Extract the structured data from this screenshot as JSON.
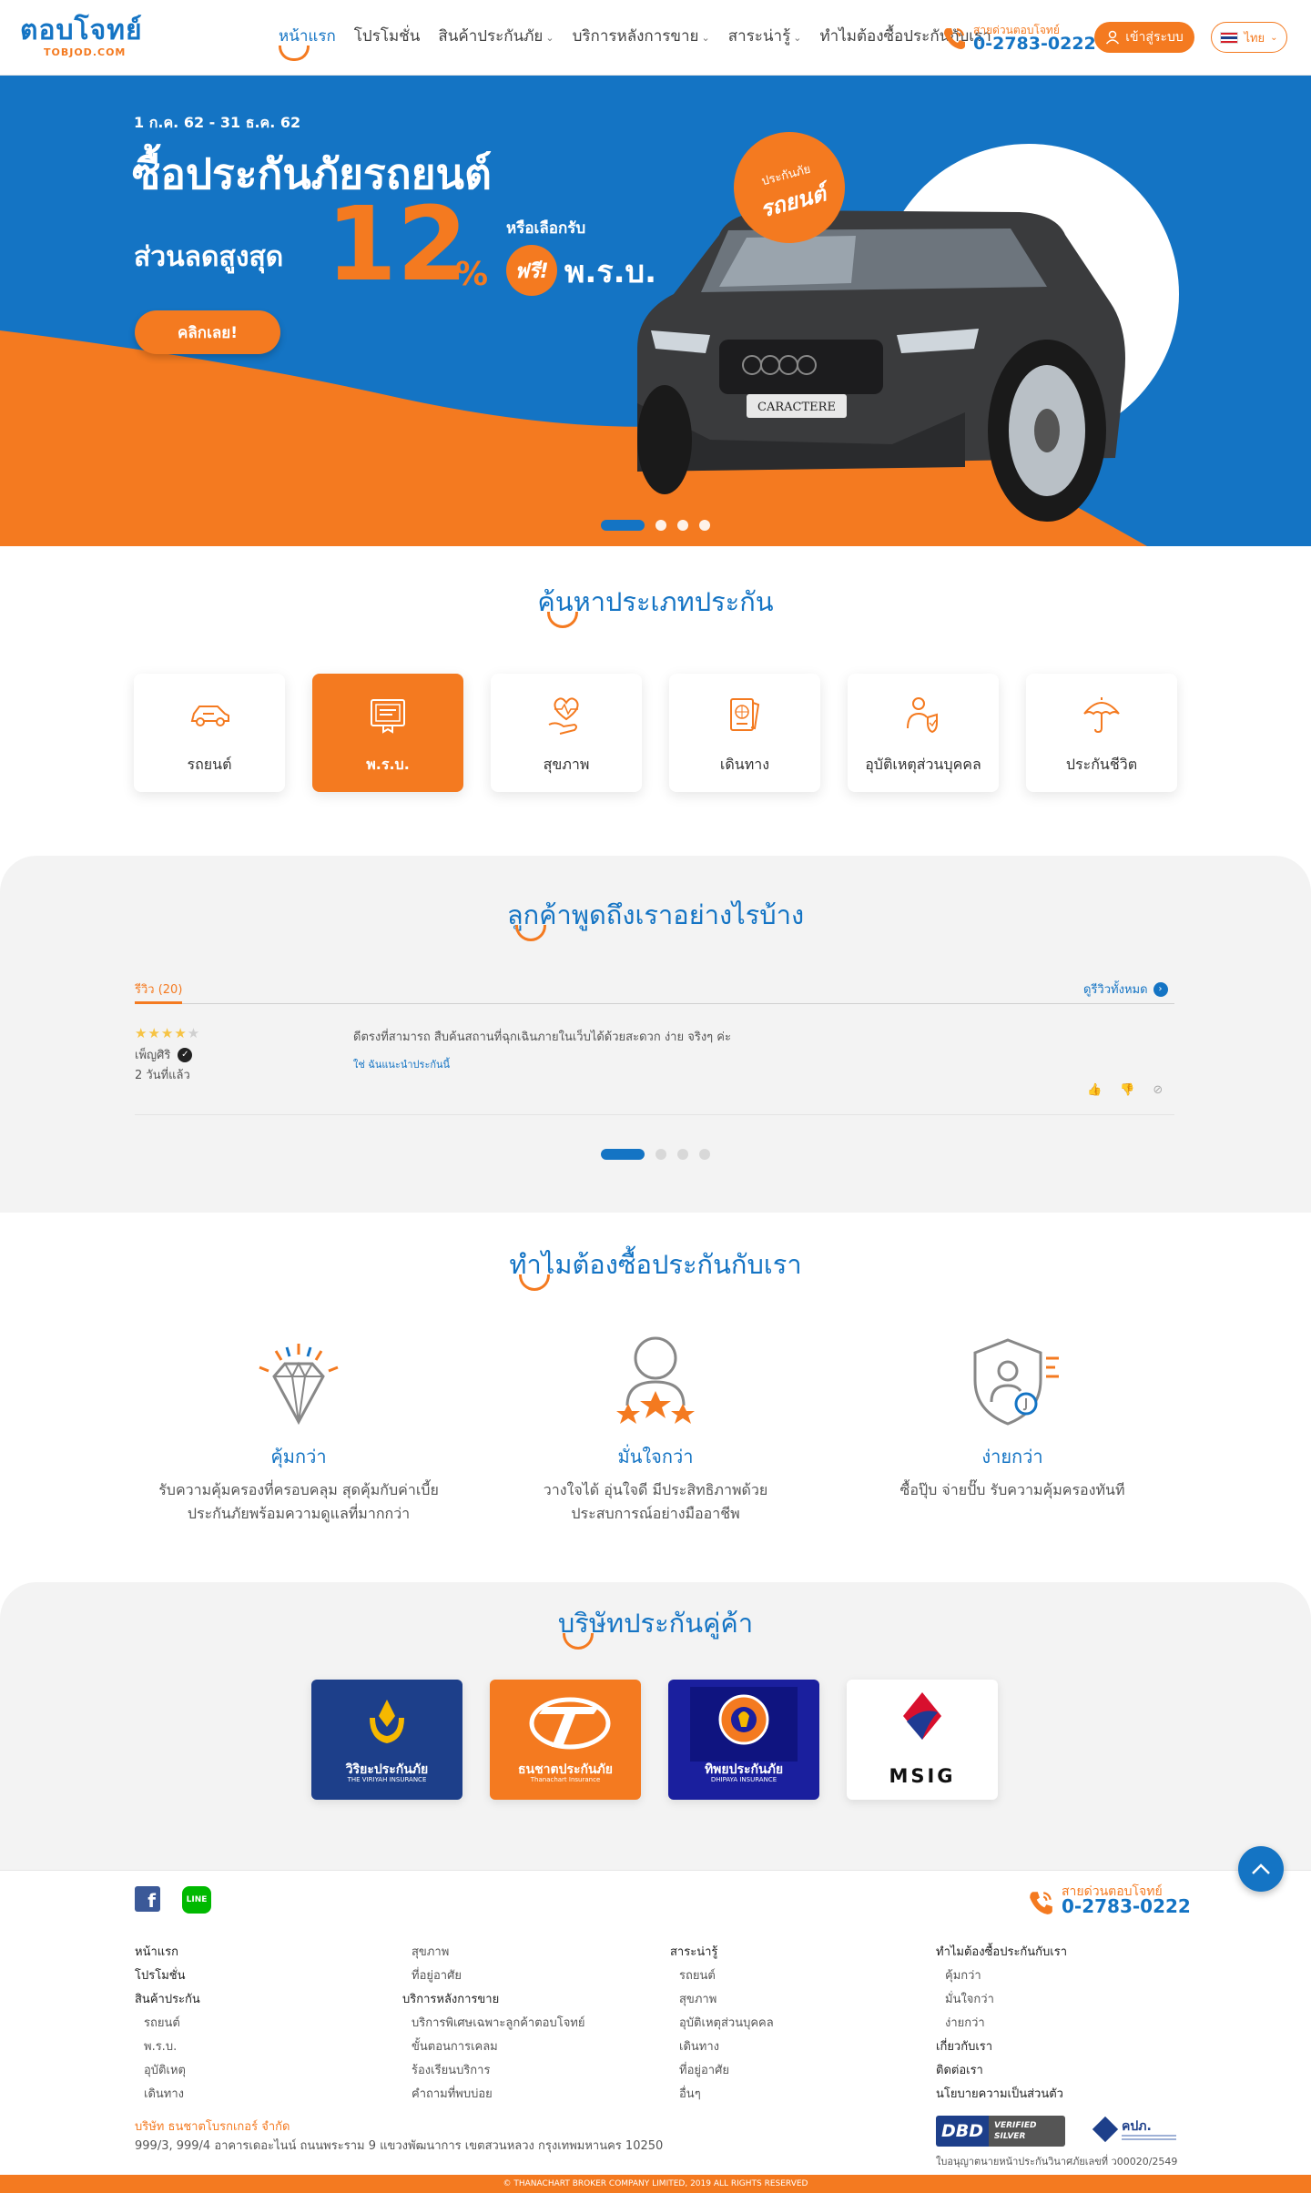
{
  "header": {
    "logo_text": "ตอบโจทย์",
    "logo_sub": "TOBJOD.COM",
    "nav": [
      {
        "label": "หน้าแรก"
      },
      {
        "label": "โปรโมชั่น"
      },
      {
        "label": "สินค้าประกันภัย"
      },
      {
        "label": "บริการหลังการขาย"
      },
      {
        "label": "สาระน่ารู้"
      },
      {
        "label": "ทำไมต้องซื้อประกันกับเรา"
      }
    ],
    "hotline_label": "สายด่วนตอบโจทย์",
    "hotline_number": "0-2783-0222",
    "login_label": "เข้าสู่ระบบ",
    "lang_label": "ไทย"
  },
  "hero": {
    "date_range": "1 ก.ค. 62 - 31 ธ.ค. 62",
    "title": "ซื้อประกันภัยรถยนต์",
    "subtitle": "ส่วนลดสูงสุด",
    "big_number": "12",
    "percent": "%",
    "or_text": "หรือเลือกรับ",
    "free_label": "ฟรี!",
    "prb_label": "พ.ร.บ.",
    "cta_label": "คลิกเลย!",
    "badge_top": "ประกันภัย",
    "badge_main": "รถยนต์",
    "plate_text": "CARACTERE",
    "slide_count": 4,
    "active_slide": 0
  },
  "search": {
    "title": "ค้นหาประเภทประกัน",
    "cards": [
      {
        "label": "รถยนต์",
        "icon": "car-icon",
        "active": false
      },
      {
        "label": "พ.ร.บ.",
        "icon": "certificate-icon",
        "active": true
      },
      {
        "label": "สุขภาพ",
        "icon": "heart-hand-icon",
        "active": false
      },
      {
        "label": "เดินทาง",
        "icon": "passport-icon",
        "active": false
      },
      {
        "label": "อุบัติเหตุส่วนบุคคล",
        "icon": "person-shield-icon",
        "active": false
      },
      {
        "label": "ประกันชีวิต",
        "icon": "umbrella-icon",
        "active": false
      }
    ]
  },
  "reviews": {
    "title": "ลูกค้าพูดถึงเราอย่างไรบ้าง",
    "tab_label": "รีวิว (20)",
    "see_all_label": "ดูรีวิวทั้งหมด",
    "items": [
      {
        "rating": 4,
        "max_rating": 5,
        "name": "เพ็ญศิริ",
        "time": "2 วันที่แล้ว",
        "text": "ดีตรงที่สามารถ สืบค้นสถานที่ฉุกเฉินภายในเว็บได้ด้วยสะดวก ง่าย จริงๆ ค่ะ",
        "recommend": "ใช่ ฉันแนะนำประกันนี้"
      }
    ],
    "slide_count": 4,
    "active_slide": 0
  },
  "why": {
    "title": "ทำไมต้องซื้อประกันกับเรา",
    "items": [
      {
        "title": "คุ้มกว่า",
        "desc": "รับความคุ้มครองที่ครอบคลุม สุดคุ้มกับค่าเบี้ยประกันภัยพร้อมความดูแลที่มากกว่า",
        "icon": "diamond-icon"
      },
      {
        "title": "มั่นใจกว่า",
        "desc": "วางใจได้ อุ่นใจดี มีประสิทธิภาพด้วยประสบการณ์อย่างมืออาชีพ",
        "icon": "person-stars-icon"
      },
      {
        "title": "ง่ายกว่า",
        "desc": "ซื้อปุ๊บ จ่ายปั๊บ รับความคุ้มครองทันที",
        "icon": "shield-user-icon"
      }
    ]
  },
  "partners": {
    "title": "บริษัทประกันคู่ค้า",
    "items": [
      {
        "name": "วิริยะประกันภัย",
        "sub": "THE VIRIYAH INSURANCE",
        "color": "#1d3f8a"
      },
      {
        "name": "ธนชาตประกันภัย",
        "sub": "Thanachart Insurance",
        "color": "#f47a20"
      },
      {
        "name": "ทิพยประกันภัย",
        "sub": "DHIPAYA INSURANCE",
        "color": "#1a1f9e"
      },
      {
        "name": "MSIG",
        "sub": "",
        "color": "#ffffff"
      }
    ]
  },
  "footer": {
    "hotline_label": "สายด่วนตอบโจทย์",
    "hotline_number": "0-2783-0222",
    "col1": [
      {
        "label": "หน้าแรก",
        "type": "head"
      },
      {
        "label": "โปรโมชั่น",
        "type": "head"
      },
      {
        "label": "สินค้าประกัน",
        "type": "head"
      },
      {
        "label": "รถยนต์",
        "type": "sub"
      },
      {
        "label": "พ.ร.บ.",
        "type": "sub"
      },
      {
        "label": "อุบัติเหตุ",
        "type": "sub"
      },
      {
        "label": "เดินทาง",
        "type": "sub"
      }
    ],
    "col2": [
      {
        "label": "สุขภาพ",
        "type": "sub"
      },
      {
        "label": "ที่อยู่อาศัย",
        "type": "sub"
      },
      {
        "label": "บริการหลังการขาย",
        "type": "head"
      },
      {
        "label": "บริการพิเศษเฉพาะลูกค้าตอบโจทย์",
        "type": "sub"
      },
      {
        "label": "ขั้นตอนการเคลม",
        "type": "sub"
      },
      {
        "label": "ร้องเรียนบริการ",
        "type": "sub"
      },
      {
        "label": "คำถามที่พบบ่อย",
        "type": "sub"
      }
    ],
    "col3": [
      {
        "label": "สาระน่ารู้",
        "type": "head"
      },
      {
        "label": "รถยนต์",
        "type": "sub"
      },
      {
        "label": "สุขภาพ",
        "type": "sub"
      },
      {
        "label": "อุบัติเหตุส่วนบุคคล",
        "type": "sub"
      },
      {
        "label": "เดินทาง",
        "type": "sub"
      },
      {
        "label": "ที่อยู่อาศัย",
        "type": "sub"
      },
      {
        "label": "อื่นๆ",
        "type": "sub"
      }
    ],
    "col4": [
      {
        "label": "ทำไมต้องซื้อประกันกับเรา",
        "type": "head"
      },
      {
        "label": "คุ้มกว่า",
        "type": "sub"
      },
      {
        "label": "มั่นใจกว่า",
        "type": "sub"
      },
      {
        "label": "ง่ายกว่า",
        "type": "sub"
      },
      {
        "label": "เกี่ยวกับเรา",
        "type": "head"
      },
      {
        "label": "ติดต่อเรา",
        "type": "head"
      },
      {
        "label": "นโยบายความเป็นส่วนตัว",
        "type": "head"
      }
    ],
    "company": "บริษัท ธนชาตโบรกเกอร์ จำกัด",
    "address": "999/3, 999/4 อาคารเดอะไนน์ ถนนพระราม 9 แขวงพัฒนาการ เขตสวนหลวง กรุงเทพมหานคร 10250",
    "dbd_label": "DBD",
    "dbd_badge": "VERIFIED SILVER",
    "oic_label": "คปภ.",
    "license": "ใบอนุญาตนายหน้าประกันวินาศภัยเลขที่ ว00020/2549",
    "copyright": "© THANACHART BROKER COMPANY LIMITED, 2019 ALL RIGHTS RESERVED"
  },
  "colors": {
    "primary_blue": "#1474c4",
    "accent_orange": "#f47a20",
    "section_gray": "#f3f3f3"
  }
}
